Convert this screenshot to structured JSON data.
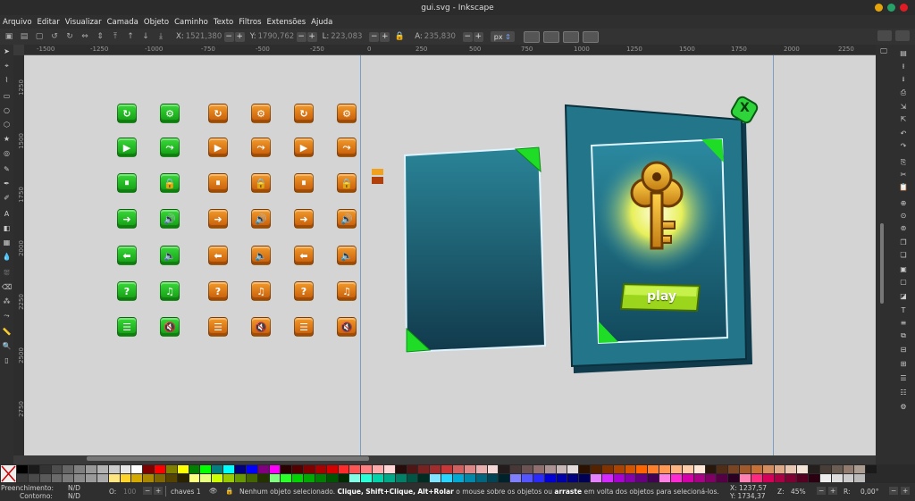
{
  "window": {
    "title": "gui.svg - Inkscape"
  },
  "menu": [
    "Arquivo",
    "Editar",
    "Visualizar",
    "Camada",
    "Objeto",
    "Caminho",
    "Texto",
    "Filtros",
    "Extensões",
    "Ajuda"
  ],
  "toolbar": {
    "x_label": "X:",
    "x_value": "1521,380",
    "y_label": "Y:",
    "y_value": "1790,762",
    "w_label": "L:",
    "w_value": "223,083",
    "h_label": "A:",
    "h_value": "235,830",
    "unit": "px"
  },
  "hruler": [
    "-1500",
    "-1250",
    "-1000",
    "-750",
    "-500",
    "-250",
    "0",
    "250",
    "500",
    "750",
    "1000",
    "1250",
    "1500",
    "1750",
    "2000",
    "2250"
  ],
  "vruler": [
    "1250",
    "1500",
    "1750",
    "2000",
    "2250",
    "2500",
    "2750"
  ],
  "canvas": {
    "play_label": "play",
    "close_label": "X",
    "green_icons": [
      "↻",
      "⚙",
      "▶",
      "⤳",
      "⏸",
      "🔒",
      "➜",
      "🔊",
      "⬅",
      "🔈",
      "?",
      "♫",
      "☰",
      "🔇"
    ],
    "orange_icons": [
      "↻",
      "⚙",
      "↻",
      "⚙",
      "▶",
      "⤳",
      "▶",
      "⤳",
      "⏸",
      "🔒",
      "⏸",
      "🔒",
      "➜",
      "🔊",
      "➜",
      "🔊",
      "⬅",
      "🔈",
      "⬅",
      "🔈",
      "?",
      "♫",
      "?",
      "♫",
      "☰",
      "🔇",
      "☰",
      "🔇"
    ]
  },
  "status": {
    "fill_label": "Preenchimento:",
    "fill_value": "N/D",
    "stroke_label": "Contorno:",
    "stroke_value": "N/D",
    "opacity_label": "O:",
    "opacity_value": "100",
    "layer": "chaves 1",
    "message_prefix": "Nenhum objeto selecionado.",
    "message_key1": "Clique,",
    "message_key2": "Shift+Clique,",
    "message_key3": "Alt+Rolar",
    "message_middle": "o mouse sobre os objetos ou",
    "message_key4": "arraste",
    "message_suffix": "em volta dos objetos para selecioná-los.",
    "cursor_x": "X: 1237,57",
    "cursor_y": "Y: 1734,37",
    "zoom_label": "Z:",
    "zoom_value": "45%",
    "rotation_label": "R:",
    "rotation_value": "0,00°"
  },
  "colors": {
    "accent_green": "#2ecc2e",
    "accent_orange": "#e2801a",
    "card_teal": "#1f6a7c"
  }
}
